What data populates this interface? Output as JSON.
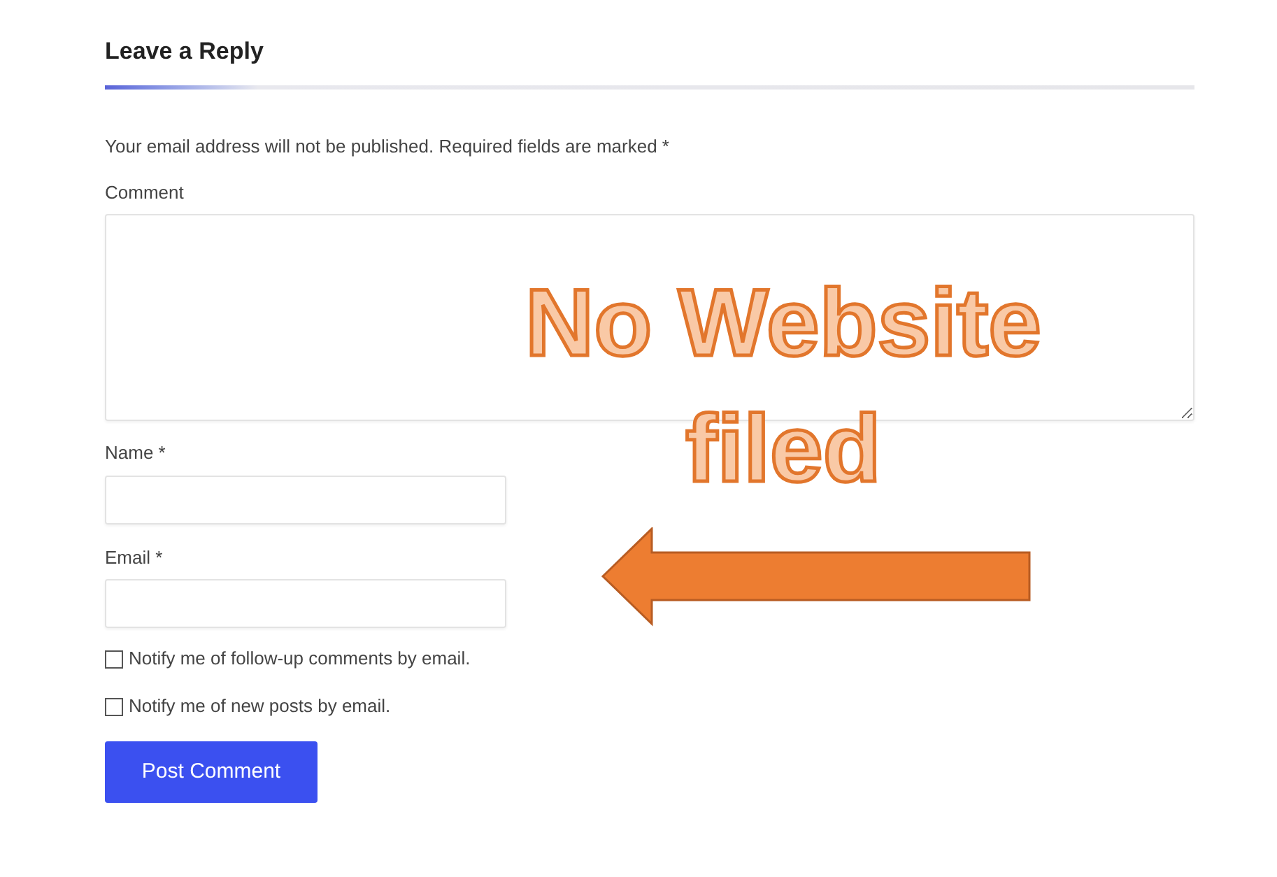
{
  "heading": "Leave a Reply",
  "notice": "Your email address will not be published. Required fields are marked *",
  "comment_label": "Comment",
  "name_label": "Name *",
  "email_label": "Email *",
  "checkboxes": [
    {
      "label": "Notify me of follow-up comments by email.",
      "checked": false
    },
    {
      "label": "Notify me of new posts by email.",
      "checked": false
    }
  ],
  "submit_button": "Post Comment",
  "annotation": {
    "text": "No Website filed"
  }
}
